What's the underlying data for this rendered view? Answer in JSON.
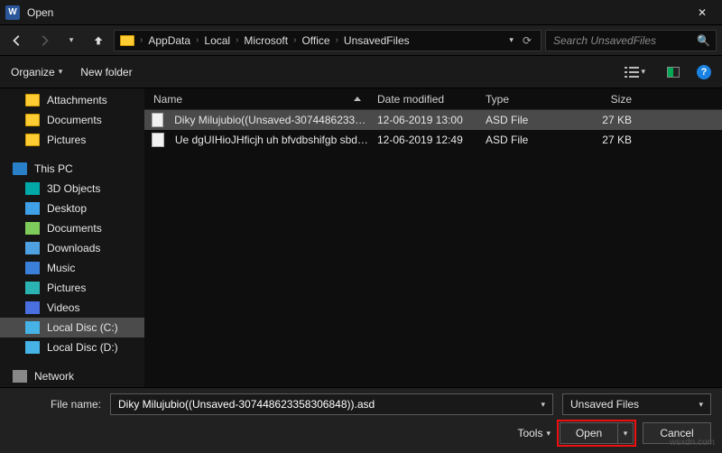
{
  "titlebar": {
    "title": "Open"
  },
  "breadcrumb": {
    "search_placeholder": "Search UnsavedFiles",
    "items": [
      "AppData",
      "Local",
      "Microsoft",
      "Office",
      "UnsavedFiles"
    ]
  },
  "toolbar": {
    "organize": "Organize",
    "new_folder": "New folder"
  },
  "sidebar": {
    "quick": [
      {
        "label": "Attachments"
      },
      {
        "label": "Documents"
      },
      {
        "label": "Pictures"
      }
    ],
    "thispc_label": "This PC",
    "thispc": [
      {
        "label": "3D Objects",
        "cls": "ic-3d"
      },
      {
        "label": "Desktop",
        "cls": "ic-desktop"
      },
      {
        "label": "Documents",
        "cls": "ic-docs"
      },
      {
        "label": "Downloads",
        "cls": "ic-down"
      },
      {
        "label": "Music",
        "cls": "ic-music"
      },
      {
        "label": "Pictures",
        "cls": "ic-pics"
      },
      {
        "label": "Videos",
        "cls": "ic-vids"
      },
      {
        "label": "Local Disc (C:)",
        "cls": "ic-disk",
        "selected": true
      },
      {
        "label": "Local Disc (D:)",
        "cls": "ic-disk"
      }
    ],
    "network_label": "Network"
  },
  "columns": {
    "name": "Name",
    "date": "Date modified",
    "type": "Type",
    "size": "Size"
  },
  "files": [
    {
      "name": "Diky Milujubio((Unsaved-3074486233583…",
      "date": "12-06-2019 13:00",
      "type": "ASD File",
      "size": "27 KB",
      "selected": true
    },
    {
      "name": "Ue dgUIHioJHficjh uh bfvdbshifgb sbdf…",
      "date": "12-06-2019 12:49",
      "type": "ASD File",
      "size": "27 KB",
      "selected": false
    }
  ],
  "footer": {
    "filename_label": "File name:",
    "filename_value": "Diky Milujubio((Unsaved-307448623358306848)).asd",
    "filter_value": "Unsaved Files",
    "tools": "Tools",
    "open": "Open",
    "cancel": "Cancel"
  },
  "watermark": "wsxdn.com"
}
